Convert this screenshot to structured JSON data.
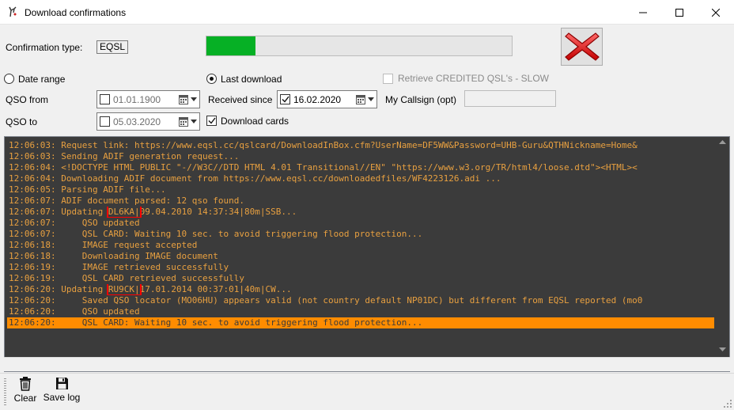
{
  "window": {
    "title": "Download confirmations"
  },
  "form": {
    "confirmation_type_label": "Confirmation type:",
    "confirmation_type_value": "EQSL",
    "progress": 0.16,
    "date_range_label": "Date range",
    "last_download_label": "Last download",
    "retrieve_credited_label": "Retrieve CREDITED QSL's - SLOW",
    "qso_from_label": "QSO from",
    "qso_from_value": "01.01.1900",
    "received_since_label": "Received since",
    "received_since_value": "16.02.2020",
    "my_callsign_label": "My Callsign (opt)",
    "my_callsign_value": "",
    "qso_to_label": "QSO to",
    "qso_to_value": "05.03.2020",
    "download_cards_label": "Download cards"
  },
  "log": {
    "lines": [
      {
        "time": "12:06:03:",
        "msg": " Request link: https://www.eqsl.cc/qslcard/DownloadInBox.cfm?UserName=DF5WW&Password=UHB-Guru&QTHNickname=Home&"
      },
      {
        "time": "12:06:03:",
        "msg": " Sending ADIF generation request..."
      },
      {
        "time": "12:06:04:",
        "msg": " <!DOCTYPE HTML PUBLIC \"-//W3C//DTD HTML 4.01 Transitional//EN\" \"https://www.w3.org/TR/html4/loose.dtd\"><HTML><"
      },
      {
        "time": "12:06:04:",
        "msg": " Downloading ADIF document from https://www.eqsl.cc/downloadedfiles/WF4223126.adi ..."
      },
      {
        "time": "12:06:05:",
        "msg": " Parsing ADIF file..."
      },
      {
        "time": "12:06:07:",
        "msg": " ADIF document parsed: 12 qso found."
      },
      {
        "time": "12:06:07:",
        "pre": " Updating ",
        "call": "DL6KA|",
        "post": "09.04.2010 14:37:34|80m|SSB..."
      },
      {
        "time": "12:06:07:",
        "msg": "     QSO updated"
      },
      {
        "time": "12:06:07:",
        "msg": "     QSL CARD: Waiting 10 sec. to avoid triggering flood protection..."
      },
      {
        "time": "12:06:18:",
        "msg": "     IMAGE request accepted"
      },
      {
        "time": "12:06:18:",
        "msg": "     Downloading IMAGE document"
      },
      {
        "time": "12:06:19:",
        "msg": "     IMAGE retrieved successfully"
      },
      {
        "time": "12:06:19:",
        "msg": "     QSL CARD retrieved successfully"
      },
      {
        "time": "12:06:20:",
        "pre": " Updating ",
        "call": "RU9CK|",
        "post": "17.01.2014 00:37:01|40m|CW..."
      },
      {
        "time": "12:06:20:",
        "msg": "     Saved QSO locator (MO06HU) appears valid (not country default NP01DC) but different from EQSL reported (mo0"
      },
      {
        "time": "12:06:20:",
        "msg": "     QSO updated"
      },
      {
        "time": "12:06:20:",
        "msg": "     QSL CARD: Waiting 10 sec. to avoid triggering flood protection...",
        "selected": true
      }
    ]
  },
  "toolbar": {
    "clear_label": "Clear",
    "save_log_label": "Save log"
  },
  "colors": {
    "log_bg": "#3b3b3b",
    "log_text": "#e8a040",
    "selected": "#ff8c00",
    "progress": "#06b025",
    "highlight": "#ff0000"
  }
}
